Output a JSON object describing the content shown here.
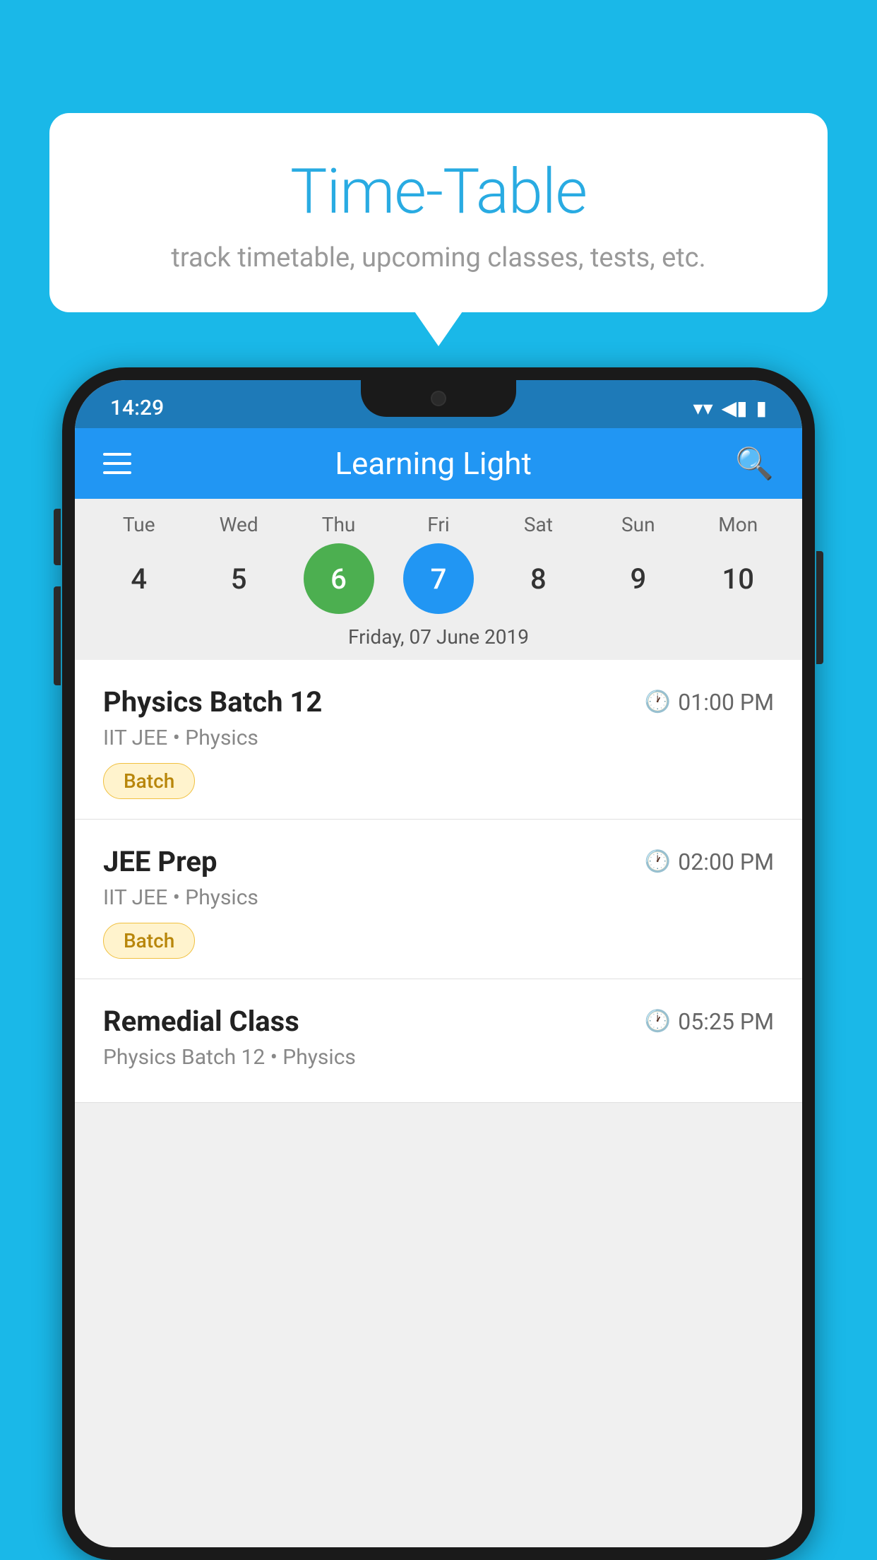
{
  "background": {
    "color": "#1ab8e8"
  },
  "speech_bubble": {
    "title": "Time-Table",
    "subtitle": "track timetable, upcoming classes, tests, etc."
  },
  "app": {
    "title": "Learning Light"
  },
  "status_bar": {
    "time": "14:29"
  },
  "calendar": {
    "selected_date_label": "Friday, 07 June 2019",
    "days": [
      {
        "abbr": "Tue",
        "number": "4",
        "state": "normal"
      },
      {
        "abbr": "Wed",
        "number": "5",
        "state": "normal"
      },
      {
        "abbr": "Thu",
        "number": "6",
        "state": "today"
      },
      {
        "abbr": "Fri",
        "number": "7",
        "state": "selected"
      },
      {
        "abbr": "Sat",
        "number": "8",
        "state": "normal"
      },
      {
        "abbr": "Sun",
        "number": "9",
        "state": "normal"
      },
      {
        "abbr": "Mon",
        "number": "10",
        "state": "normal"
      }
    ]
  },
  "schedule": {
    "items": [
      {
        "title": "Physics Batch 12",
        "time": "01:00 PM",
        "subtitle": "IIT JEE • Physics",
        "badge": "Batch"
      },
      {
        "title": "JEE Prep",
        "time": "02:00 PM",
        "subtitle": "IIT JEE • Physics",
        "badge": "Batch"
      },
      {
        "title": "Remedial Class",
        "time": "05:25 PM",
        "subtitle": "Physics Batch 12 • Physics",
        "badge": ""
      }
    ]
  },
  "icons": {
    "menu": "hamburger-menu-icon",
    "search": "search-icon",
    "clock": "⏱",
    "wifi": "▼",
    "signal": "◄",
    "battery": "▮"
  }
}
